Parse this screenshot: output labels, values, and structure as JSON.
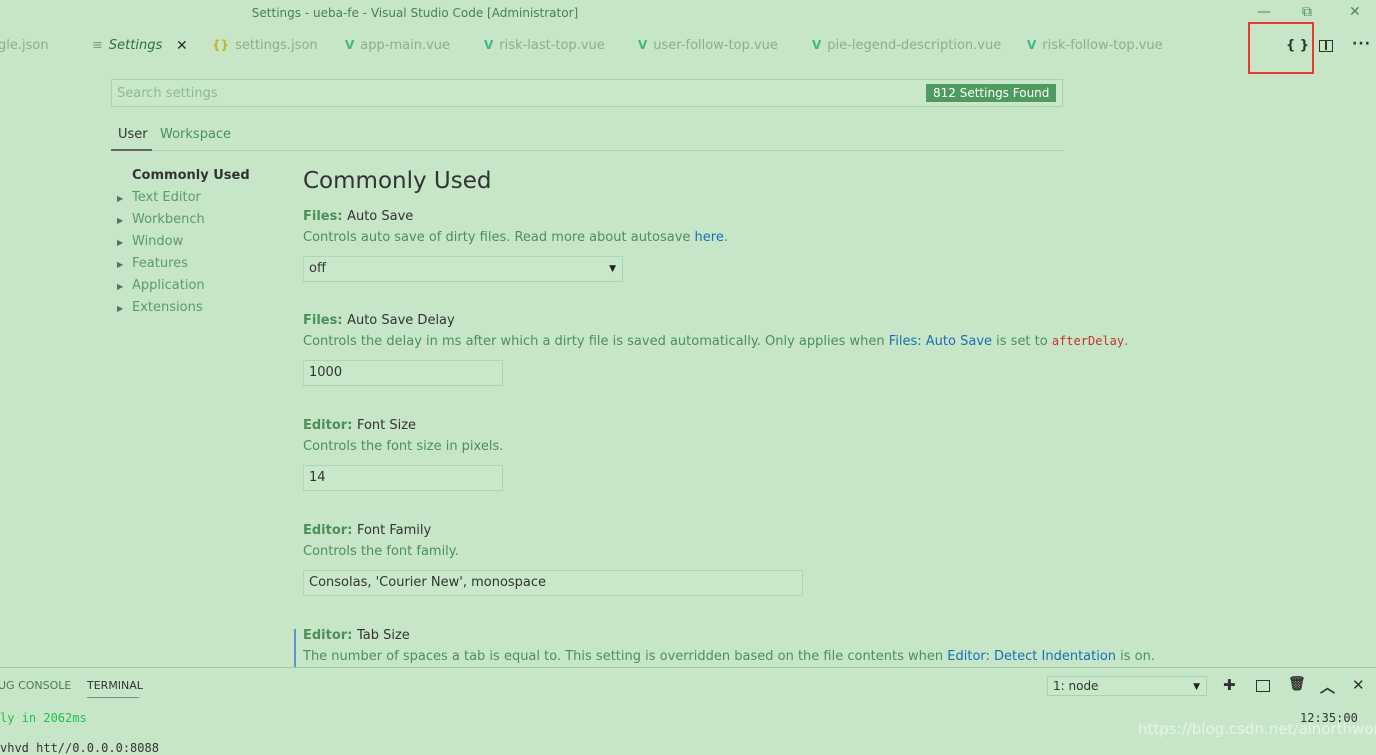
{
  "window": {
    "title": "Settings - ueba-fe - Visual Studio Code [Administrator]",
    "controls": [
      "—",
      "⧉",
      "✕"
    ]
  },
  "tabs": [
    {
      "label": "gle.json",
      "icon": "brace-icon"
    },
    {
      "label": "Settings",
      "icon": "settings-file-icon",
      "active": true
    },
    {
      "label": "settings.json",
      "icon": "brace-icon"
    },
    {
      "label": "app-main.vue",
      "icon": "vue-icon"
    },
    {
      "label": "risk-last-top.vue",
      "icon": "vue-icon"
    },
    {
      "label": "user-follow-top.vue",
      "icon": "vue-icon"
    },
    {
      "label": "pie-legend-description.vue",
      "icon": "vue-icon"
    },
    {
      "label": "risk-follow-top.vue",
      "icon": "vue-icon"
    }
  ],
  "toolbar": {
    "open_json": "{ }",
    "more": "···"
  },
  "search": {
    "placeholder": "Search settings",
    "count": "812 Settings Found"
  },
  "scope": {
    "user": "User",
    "workspace": "Workspace"
  },
  "toc": [
    {
      "label": "Commonly Used"
    },
    {
      "label": "Text Editor"
    },
    {
      "label": "Workbench"
    },
    {
      "label": "Window"
    },
    {
      "label": "Features"
    },
    {
      "label": "Application"
    },
    {
      "label": "Extensions"
    }
  ],
  "section_title": "Commonly Used",
  "settings": {
    "auto_save": {
      "category": "Files: ",
      "name": "Auto Save",
      "desc": "Controls auto save of dirty files. Read more about autosave ",
      "link": "here",
      "desc_end": ".",
      "value": "off"
    },
    "auto_save_delay": {
      "category": "Files: ",
      "name": "Auto Save Delay",
      "desc": "Controls the delay in ms after which a dirty file is saved automatically. Only applies when ",
      "link": "Files: Auto Save",
      "desc_mid": " is set to ",
      "code": "afterDelay",
      "desc_end": ".",
      "value": "1000"
    },
    "font_size": {
      "category": "Editor: ",
      "name": "Font Size",
      "desc": "Controls the font size in pixels.",
      "value": "14"
    },
    "font_family": {
      "category": "Editor: ",
      "name": "Font Family",
      "desc": "Controls the font family.",
      "value": "Consolas, 'Courier New', monospace"
    },
    "tab_size": {
      "category": "Editor: ",
      "name": "Tab Size",
      "desc": "The number of spaces a tab is equal to. This setting is overridden based on the file contents when ",
      "link": "Editor: Detect Indentation",
      "desc_end": " is on."
    }
  },
  "panel": {
    "tabs": [
      "UG CONSOLE",
      "TERMINAL"
    ],
    "terminal_select": "1: node",
    "line1": "ly in 2062ms",
    "line2": "vhvd  htt//0.0.0.0:8088",
    "clock": "12:35:00"
  },
  "watermark": "https://blog.csdn.net/alnorthword"
}
